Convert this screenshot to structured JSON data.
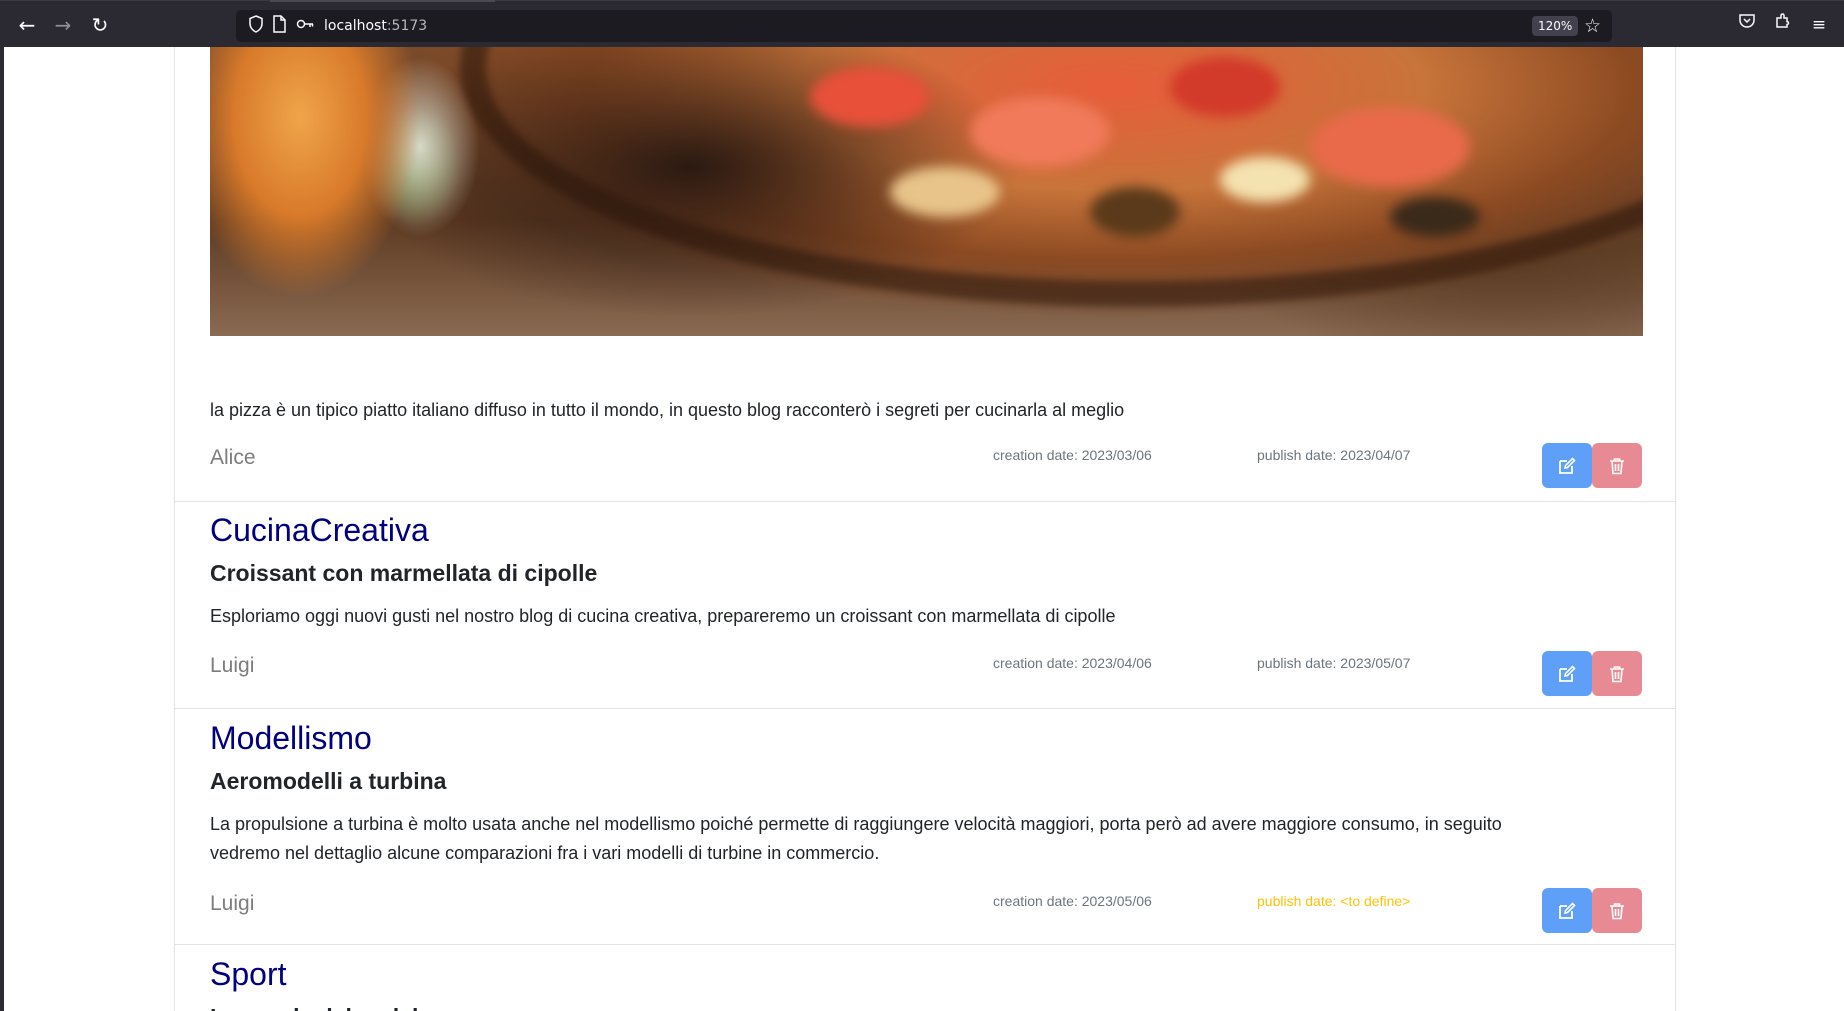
{
  "browser": {
    "url_host": "localhost",
    "url_port": ":5173",
    "zoom": "120%"
  },
  "posts": [
    {
      "description": "la pizza è un tipico piatto italiano diffuso in tutto il mondo, in questo blog racconterò i segreti per cucinarla al meglio",
      "author": "Alice",
      "creation_date": "creation date: 2023/03/06",
      "publish_date": "publish date: 2023/04/07"
    },
    {
      "blog": "CucinaCreativa",
      "title": "Croissant con marmellata di cipolle",
      "description": "Esploriamo oggi nuovi gusti nel nostro blog di cucina creativa, prepareremo un croissant con marmellata di cipolle",
      "author": "Luigi",
      "creation_date": "creation date: 2023/04/06",
      "publish_date": "publish date: 2023/05/07"
    },
    {
      "blog": "Modellismo",
      "title": "Aeromodelli a turbina",
      "description_line1": "La propulsione a turbina è molto usata anche nel modellismo poiché permette di raggiungere velocità maggiori, porta però ad avere maggiore consumo, in seguito",
      "description_line2": "vedremo nel dettaglio alcune comparazioni fra i vari modelli di turbine in commercio.",
      "author": "Luigi",
      "creation_date": "creation date: 2023/05/06",
      "publish_date": "publish date: <to define>"
    },
    {
      "blog": "Sport",
      "title": "Le regole del padel"
    }
  ],
  "colors": {
    "blog_name": "#000080",
    "edit_button": "#5ea0f7",
    "delete_button": "#e88a93",
    "undefined_date": "#ffc107"
  }
}
